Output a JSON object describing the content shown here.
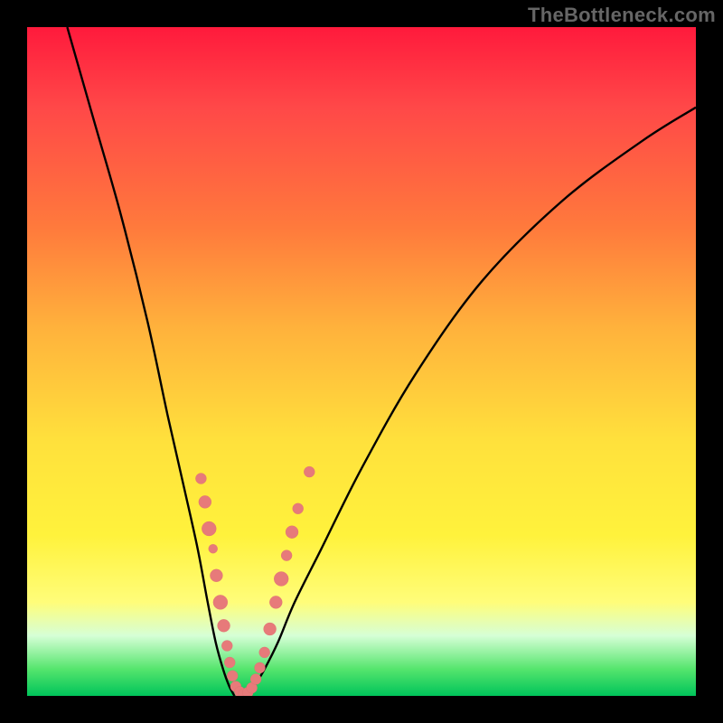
{
  "watermark": "TheBottleneck.com",
  "chart_data": {
    "type": "line",
    "title": "",
    "xlabel": "",
    "ylabel": "",
    "xlim": [
      0,
      100
    ],
    "ylim": [
      0,
      100
    ],
    "grid": false,
    "legend": false,
    "series": [
      {
        "name": "left-curve",
        "x": [
          6,
          10,
          14,
          18,
          21,
          23.5,
          25.5,
          27,
          28.2,
          29.3,
          30.2,
          31
        ],
        "y": [
          100,
          86,
          72,
          56,
          42,
          31,
          22,
          14,
          8,
          4,
          1.5,
          0
        ]
      },
      {
        "name": "right-curve",
        "x": [
          33,
          34,
          35.5,
          37.5,
          40,
          44,
          50,
          58,
          68,
          80,
          92,
          100
        ],
        "y": [
          0,
          1.5,
          4,
          8,
          14,
          22,
          34,
          48,
          62,
          74,
          83,
          88
        ]
      }
    ],
    "scatter": {
      "name": "dots",
      "color": "#e77a7a",
      "points": [
        {
          "x": 26.0,
          "y": 32.5,
          "r": 6
        },
        {
          "x": 26.6,
          "y": 29.0,
          "r": 7
        },
        {
          "x": 27.2,
          "y": 25.0,
          "r": 8
        },
        {
          "x": 27.8,
          "y": 22.0,
          "r": 5
        },
        {
          "x": 28.3,
          "y": 18.0,
          "r": 7
        },
        {
          "x": 28.9,
          "y": 14.0,
          "r": 8
        },
        {
          "x": 29.4,
          "y": 10.5,
          "r": 7
        },
        {
          "x": 29.9,
          "y": 7.5,
          "r": 6
        },
        {
          "x": 30.3,
          "y": 5.0,
          "r": 6
        },
        {
          "x": 30.7,
          "y": 3.0,
          "r": 6
        },
        {
          "x": 31.2,
          "y": 1.4,
          "r": 6
        },
        {
          "x": 31.8,
          "y": 0.6,
          "r": 6
        },
        {
          "x": 32.4,
          "y": 0.3,
          "r": 6
        },
        {
          "x": 33.0,
          "y": 0.5,
          "r": 6
        },
        {
          "x": 33.6,
          "y": 1.2,
          "r": 6
        },
        {
          "x": 34.2,
          "y": 2.5,
          "r": 6
        },
        {
          "x": 34.8,
          "y": 4.2,
          "r": 6
        },
        {
          "x": 35.5,
          "y": 6.5,
          "r": 6
        },
        {
          "x": 36.3,
          "y": 10.0,
          "r": 7
        },
        {
          "x": 37.2,
          "y": 14.0,
          "r": 7
        },
        {
          "x": 38.0,
          "y": 17.5,
          "r": 8
        },
        {
          "x": 38.8,
          "y": 21.0,
          "r": 6
        },
        {
          "x": 39.6,
          "y": 24.5,
          "r": 7
        },
        {
          "x": 40.5,
          "y": 28.0,
          "r": 6
        },
        {
          "x": 42.2,
          "y": 33.5,
          "r": 6
        }
      ]
    },
    "colors": {
      "gradient_top": "#ff1a3c",
      "gradient_mid": "#ffe13c",
      "gradient_bottom": "#00c45a",
      "dot_color": "#e77a7a",
      "frame": "#000000"
    }
  }
}
